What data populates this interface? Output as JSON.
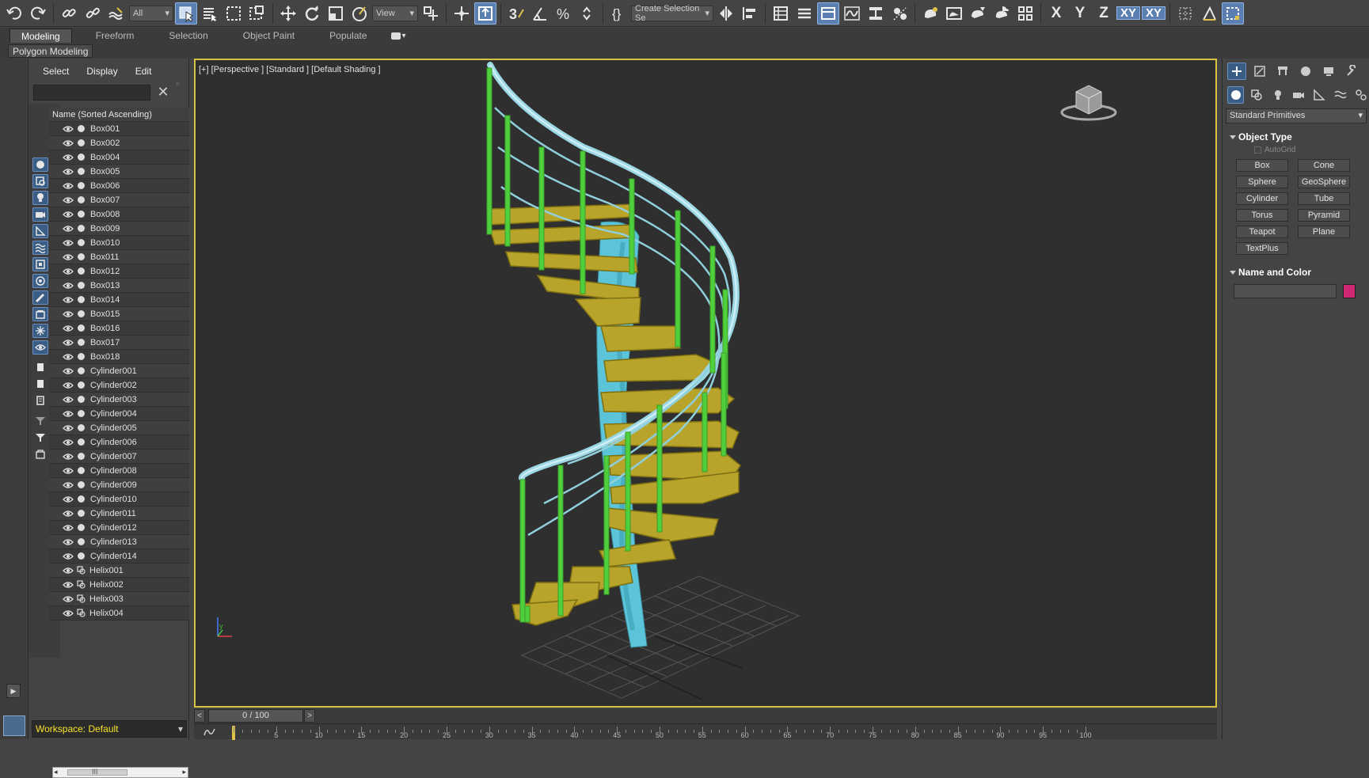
{
  "toolbar": {
    "selection_filter": "All",
    "ref_coord": "View",
    "named_selection": "Create Selection Se",
    "axis_labels": [
      "X",
      "Y",
      "Z",
      "XY",
      "XY"
    ]
  },
  "ribbon": {
    "tabs": [
      "Modeling",
      "Freeform",
      "Selection",
      "Object Paint",
      "Populate"
    ],
    "active_tab": "Modeling",
    "panel_label": "Polygon Modeling"
  },
  "explorer": {
    "menu": [
      "Select",
      "Display",
      "Edit"
    ],
    "search_value": "",
    "header": "Name (Sorted Ascending)",
    "items": [
      {
        "name": "Box001",
        "type": "geometry"
      },
      {
        "name": "Box002",
        "type": "geometry"
      },
      {
        "name": "Box004",
        "type": "geometry"
      },
      {
        "name": "Box005",
        "type": "geometry"
      },
      {
        "name": "Box006",
        "type": "geometry"
      },
      {
        "name": "Box007",
        "type": "geometry"
      },
      {
        "name": "Box008",
        "type": "geometry"
      },
      {
        "name": "Box009",
        "type": "geometry"
      },
      {
        "name": "Box010",
        "type": "geometry"
      },
      {
        "name": "Box011",
        "type": "geometry"
      },
      {
        "name": "Box012",
        "type": "geometry"
      },
      {
        "name": "Box013",
        "type": "geometry"
      },
      {
        "name": "Box014",
        "type": "geometry"
      },
      {
        "name": "Box015",
        "type": "geometry"
      },
      {
        "name": "Box016",
        "type": "geometry"
      },
      {
        "name": "Box017",
        "type": "geometry"
      },
      {
        "name": "Box018",
        "type": "geometry"
      },
      {
        "name": "Cylinder001",
        "type": "geometry"
      },
      {
        "name": "Cylinder002",
        "type": "geometry"
      },
      {
        "name": "Cylinder003",
        "type": "geometry"
      },
      {
        "name": "Cylinder004",
        "type": "geometry"
      },
      {
        "name": "Cylinder005",
        "type": "geometry"
      },
      {
        "name": "Cylinder006",
        "type": "geometry"
      },
      {
        "name": "Cylinder007",
        "type": "geometry"
      },
      {
        "name": "Cylinder008",
        "type": "geometry"
      },
      {
        "name": "Cylinder009",
        "type": "geometry"
      },
      {
        "name": "Cylinder010",
        "type": "geometry"
      },
      {
        "name": "Cylinder011",
        "type": "geometry"
      },
      {
        "name": "Cylinder012",
        "type": "geometry"
      },
      {
        "name": "Cylinder013",
        "type": "geometry"
      },
      {
        "name": "Cylinder014",
        "type": "geometry"
      },
      {
        "name": "Helix001",
        "type": "shape"
      },
      {
        "name": "Helix002",
        "type": "shape"
      },
      {
        "name": "Helix003",
        "type": "shape"
      },
      {
        "name": "Helix004",
        "type": "shape"
      }
    ],
    "scroll_glyph": "III",
    "workspace": "Workspace: Default"
  },
  "viewport": {
    "label": "[+] [Perspective ] [Standard ] [Default Shading ]",
    "colors": {
      "treads": "#b8a42a",
      "balusters": "#4fcf3c",
      "column": "#5cc4d8",
      "rail": "#9ad6e3",
      "border": "#d6c341"
    }
  },
  "timeline": {
    "frame": "0 / 100",
    "prev": "<",
    "next": ">",
    "ticks": [
      "5",
      "10",
      "15",
      "20",
      "25",
      "30",
      "35",
      "40",
      "45",
      "50",
      "55",
      "60",
      "65",
      "70",
      "75",
      "80",
      "85",
      "90",
      "95",
      "100"
    ]
  },
  "command_panel": {
    "category": "Standard Primitives",
    "object_type_title": "Object Type",
    "autogrid": "AutoGrid",
    "buttons": [
      "Box",
      "Cone",
      "Sphere",
      "GeoSphere",
      "Cylinder",
      "Tube",
      "Torus",
      "Pyramid",
      "Teapot",
      "Plane",
      "TextPlus"
    ],
    "name_color_title": "Name and Color",
    "name_value": "",
    "object_color": "#d02872"
  }
}
